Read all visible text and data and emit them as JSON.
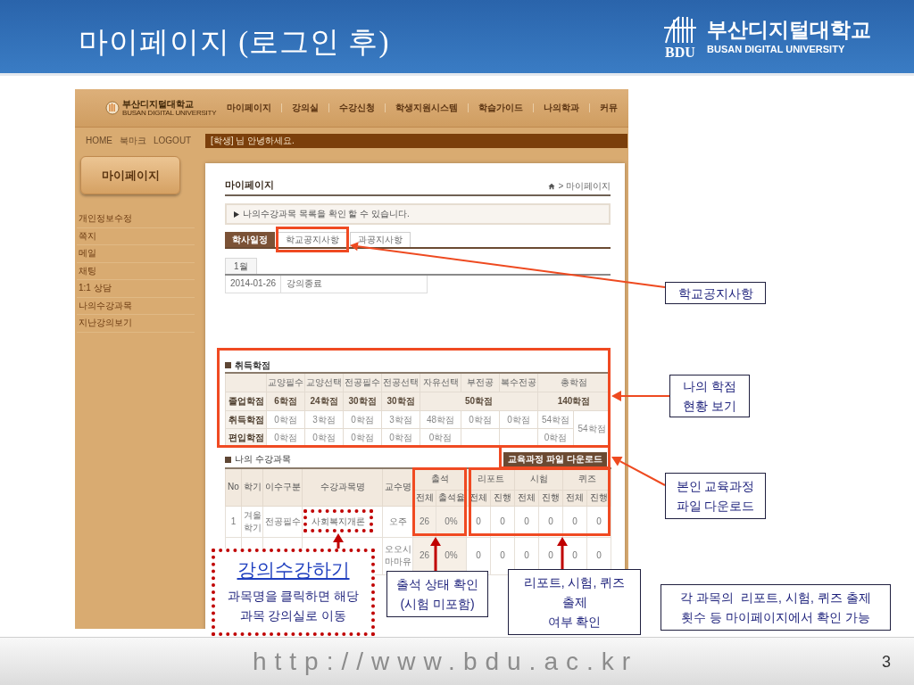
{
  "slide": {
    "title": "마이페이지 (로그인 후)",
    "logo": {
      "emblem_text": "BDU",
      "name": "부산디지털대학교",
      "name_en": "BUSAN DIGITAL UNIVERSITY"
    },
    "url": "http://www.bdu.ac.kr",
    "page_number": "3"
  },
  "screenshot": {
    "header": {
      "logo": {
        "name": "부산디지털대학교",
        "name_en": "BUSAN DIGITAL UNIVERSITY"
      },
      "nav": [
        "마이페이지",
        "강의실",
        "수강신청",
        "학생지원시스템",
        "학습가이드",
        "나의학과",
        "커뮤"
      ],
      "util_links": [
        "HOME",
        "북마크",
        "LOGOUT"
      ],
      "greeting": "[학생] 님 안녕하세요."
    },
    "sidebar": {
      "title": "마이페이지",
      "items": [
        "개인정보수정",
        "쪽지",
        "메일",
        "채팅",
        "1:1 상담",
        "나의수강과목",
        "지난강의보기"
      ]
    },
    "content": {
      "title": "마이페이지",
      "breadcrumb": "> 마이페이지",
      "notice": "나의수강과목 목록을 확인 할 수 있습니다.",
      "tabs": [
        {
          "label": "학사일정",
          "selected": true
        },
        {
          "label": "학교공지사항",
          "selected": false
        },
        {
          "label": "과공지사항",
          "selected": false
        }
      ],
      "month_tab": "1월",
      "schedule": [
        {
          "date": "2014-01-26",
          "event": "강의종료"
        }
      ],
      "credits": {
        "title": "취득학점",
        "columns": [
          "교양필수",
          "교양선택",
          "전공필수",
          "전공선택",
          "자유선택",
          "부전공",
          "복수전공",
          {
            "text": "총학점",
            "colspan": 2
          }
        ],
        "rows": [
          {
            "kind": "required",
            "label": "졸업학점",
            "cells": [
              "6학점",
              "24학점",
              "30학점",
              "30학점",
              {
                "text": "50학점",
                "colspan": 3
              },
              {
                "text": "140학점",
                "colspan": 2
              }
            ]
          },
          {
            "kind": "earned",
            "label": "취득학점",
            "cells": [
              "0학점",
              "3학점",
              "0학점",
              "3학점",
              "48학점",
              "0학점",
              "0학점",
              "54학점",
              {
                "text": "54학점",
                "rowspan": 2
              }
            ]
          },
          {
            "kind": "transfer",
            "label": "편입학점",
            "cells": [
              "0학점",
              "0학점",
              "0학점",
              "0학점",
              "0학점",
              null,
              null,
              "0학점"
            ]
          }
        ]
      },
      "download_button": "교육과정 파일 다운로드",
      "courses": {
        "title": "나의 수강과목",
        "columns": [
          "No",
          "학기",
          "이수구분",
          "수강과목명",
          "교수명"
        ],
        "groups": [
          {
            "label": "출석",
            "subcolumns": [
              "전체",
              "출석율"
            ]
          },
          {
            "label": "리포트",
            "subcolumns": [
              "전체",
              "진행"
            ]
          },
          {
            "label": "시험",
            "subcolumns": [
              "전체",
              "진행"
            ]
          },
          {
            "label": "퀴즈",
            "subcolumns": [
              "전체",
              "진행"
            ]
          }
        ],
        "rows": [
          {
            "no": "1",
            "term": "겨울학기",
            "category": "전공필수",
            "course": "사회복지개론",
            "professor": "오주",
            "values": [
              "26",
              "0%",
              "0",
              "0",
              "0",
              "0",
              "0",
              "0"
            ]
          },
          {
            "professor": "오오시마마유",
            "values": [
              "26",
              "0%",
              "0",
              "0",
              "0",
              "0",
              "0",
              "0"
            ]
          }
        ]
      }
    }
  },
  "callouts": [
    {
      "kind": "box",
      "lines": [
        "학교공지사항"
      ]
    },
    {
      "kind": "box",
      "lines": [
        "나의 학점",
        "현황 보기"
      ]
    },
    {
      "kind": "box",
      "lines": [
        "본인 교육과정",
        "파일 다운로드"
      ]
    },
    {
      "kind": "link",
      "title": "강의수강하기",
      "lines": [
        "과목명을 클릭하면 해당",
        "과목 강의실로 이동"
      ]
    },
    {
      "kind": "box",
      "lines": [
        "출석 상태 확인",
        "(시험 미포함)"
      ]
    },
    {
      "kind": "box",
      "lines": [
        "리포트, 시험, 퀴즈",
        "출제",
        "여부 확인"
      ]
    },
    {
      "kind": "box",
      "lines": [
        "각 과목의  리포트, 시험, 퀴즈 출제",
        "횟수 등 마이페이지에서 확인 가능"
      ]
    }
  ]
}
